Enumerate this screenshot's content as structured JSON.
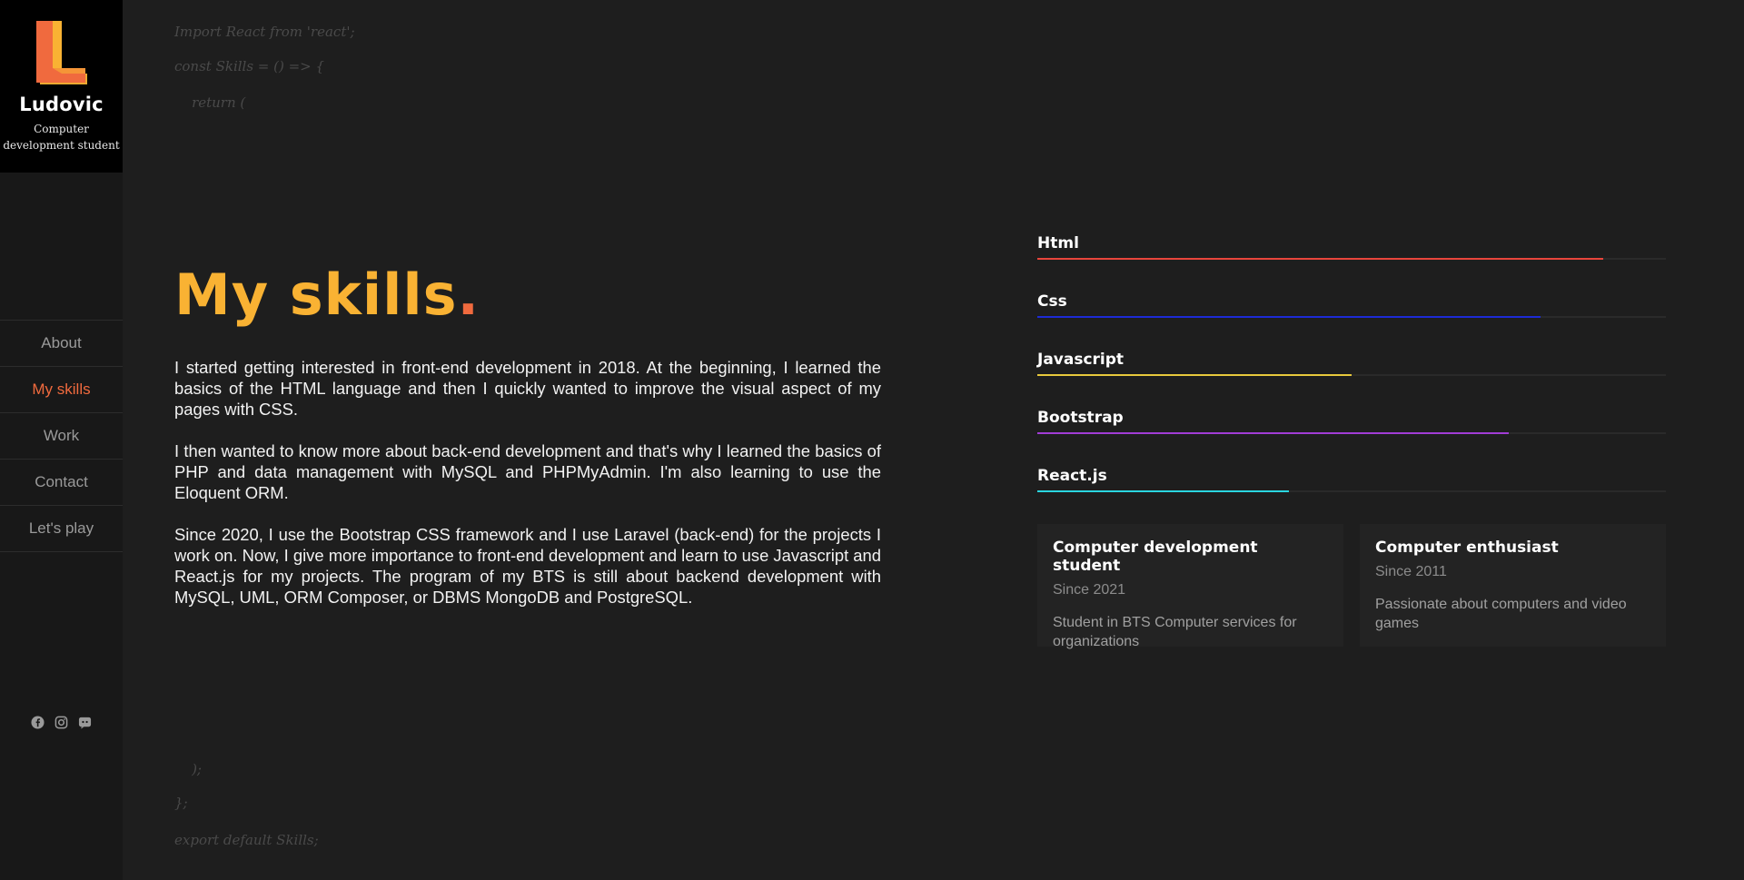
{
  "brand": {
    "name": "Ludovic",
    "subtitle": "Computer development student",
    "logo_letter": "L",
    "colors": {
      "primary": "#f06a3e",
      "accent": "#f9b233"
    }
  },
  "nav": {
    "items": [
      {
        "label": "About",
        "active": false
      },
      {
        "label": "My skills",
        "active": true
      },
      {
        "label": "Work",
        "active": false
      },
      {
        "label": "Contact",
        "active": false
      },
      {
        "label": "Let's play",
        "active": false
      }
    ]
  },
  "socials": [
    "facebook-icon",
    "instagram-icon",
    "discord-icon"
  ],
  "code": {
    "line1": "Import React from 'react';",
    "line2": "const Skills = () => {",
    "line3": "    return (",
    "line4": "    );",
    "line5": "};",
    "line6": "export default Skills;"
  },
  "main": {
    "title": "My skills",
    "title_dot": ".",
    "paragraphs": [
      "I started getting interested in front-end development in 2018. At the beginning, I learned the basics of the HTML language and then I quickly wanted to improve the visual aspect of my pages with CSS.",
      "I then wanted to know more about back-end development and that's why I learned the basics of PHP and data management with MySQL and PHPMyAdmin. I'm also learning to use the Eloquent ORM.",
      "Since 2020, I use the Bootstrap CSS framework and I use Laravel (back-end) for the projects I work on. Now, I give more importance to front-end development and learn to use Javascript and React.js for my projects. The program of my BTS is still about backend development with MySQL, UML, ORM Composer, or DBMS MongoDB and PostgreSQL."
    ]
  },
  "skills": [
    {
      "name": "Html",
      "level": 0.9,
      "color": "#e8453c"
    },
    {
      "name": "Css",
      "level": 0.8,
      "color": "#1d2bd6"
    },
    {
      "name": "Javascript",
      "level": 0.5,
      "color": "#e8c93c"
    },
    {
      "name": "Bootstrap",
      "level": 0.75,
      "color": "#a23cd6"
    },
    {
      "name": "React.js",
      "level": 0.4,
      "color": "#2bd6e0"
    }
  ],
  "cards": [
    {
      "title": "Computer development student",
      "since": "Since 2021",
      "desc": "Student in BTS Computer services for organizations"
    },
    {
      "title": "Computer enthusiast",
      "since": "Since 2011",
      "desc": "Passionate about computers and video games"
    }
  ]
}
